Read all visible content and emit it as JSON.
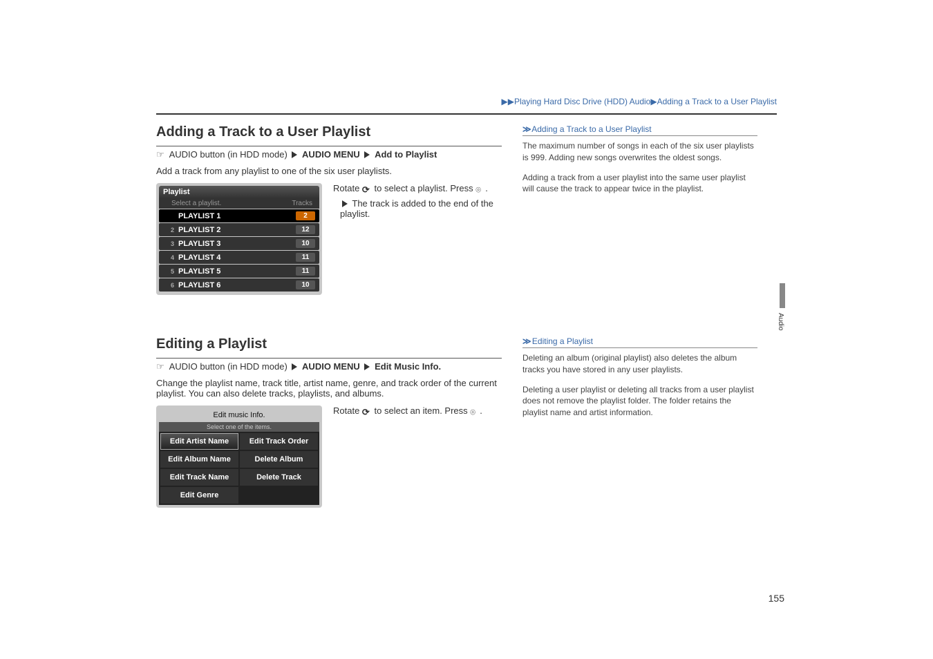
{
  "breadcrumb": {
    "parts": [
      "▶▶Playing Hard Disc Drive (HDD) Audio",
      "▶Adding a Track to a User Playlist"
    ]
  },
  "section1": {
    "title": "Adding a Track to a User Playlist",
    "nav_prefix": "AUDIO button (in HDD mode)",
    "nav_b1": "AUDIO MENU",
    "nav_b2": "Add to Playlist",
    "intro": "Add a track from any playlist to one of the six user playlists.",
    "instr1a": "Rotate ",
    "instr1b": " to select a playlist. Press ",
    "instr1c": ".",
    "bullet": "The track is added to the end of the playlist."
  },
  "ss1": {
    "title": "Playlist",
    "sub": "Select a playlist.",
    "th_right": "Tracks",
    "rows": [
      {
        "idx": "",
        "name": "PLAYLIST 1",
        "count": "2",
        "sel": true
      },
      {
        "idx": "2",
        "name": "PLAYLIST 2",
        "count": "12",
        "sel": false
      },
      {
        "idx": "3",
        "name": "PLAYLIST 3",
        "count": "10",
        "sel": false
      },
      {
        "idx": "4",
        "name": "PLAYLIST 4",
        "count": "11",
        "sel": false
      },
      {
        "idx": "5",
        "name": "PLAYLIST 5",
        "count": "11",
        "sel": false
      },
      {
        "idx": "6",
        "name": "PLAYLIST 6",
        "count": "10",
        "sel": false
      }
    ]
  },
  "section2": {
    "title": "Editing a Playlist",
    "nav_prefix": "AUDIO button (in HDD mode)",
    "nav_b1": "AUDIO MENU",
    "nav_b2": "Edit Music Info.",
    "intro": "Change the playlist name, track title, artist name, genre, and track order of the current playlist. You can also delete tracks, playlists, and albums.",
    "instr": "Rotate ",
    "instr_mid": " to select an item. Press ",
    "instr_end": "."
  },
  "ss2": {
    "title": "Edit music Info.",
    "sub": "Select one of the items.",
    "cells": [
      "Edit Artist Name",
      "Edit Track Order",
      "Edit Album Name",
      "Delete Album",
      "Edit Track Name",
      "Delete Track",
      "Edit Genre",
      ""
    ]
  },
  "right1": {
    "heading": "Adding a Track to a User Playlist",
    "p1": "The maximum number of songs in each of the six user playlists is 999. Adding new songs overwrites the oldest songs.",
    "p2": "Adding a track from a user playlist into the same user playlist will cause the track to appear twice in the playlist."
  },
  "right2": {
    "heading": "Editing a Playlist",
    "p1": "Deleting an album (original playlist) also deletes the album tracks you have stored in any user playlists.",
    "p2": "Deleting a user playlist or deleting all tracks from a user playlist does not remove the playlist folder. The folder retains the playlist name and artist information."
  },
  "side_tab": "Audio",
  "page_number": "155"
}
